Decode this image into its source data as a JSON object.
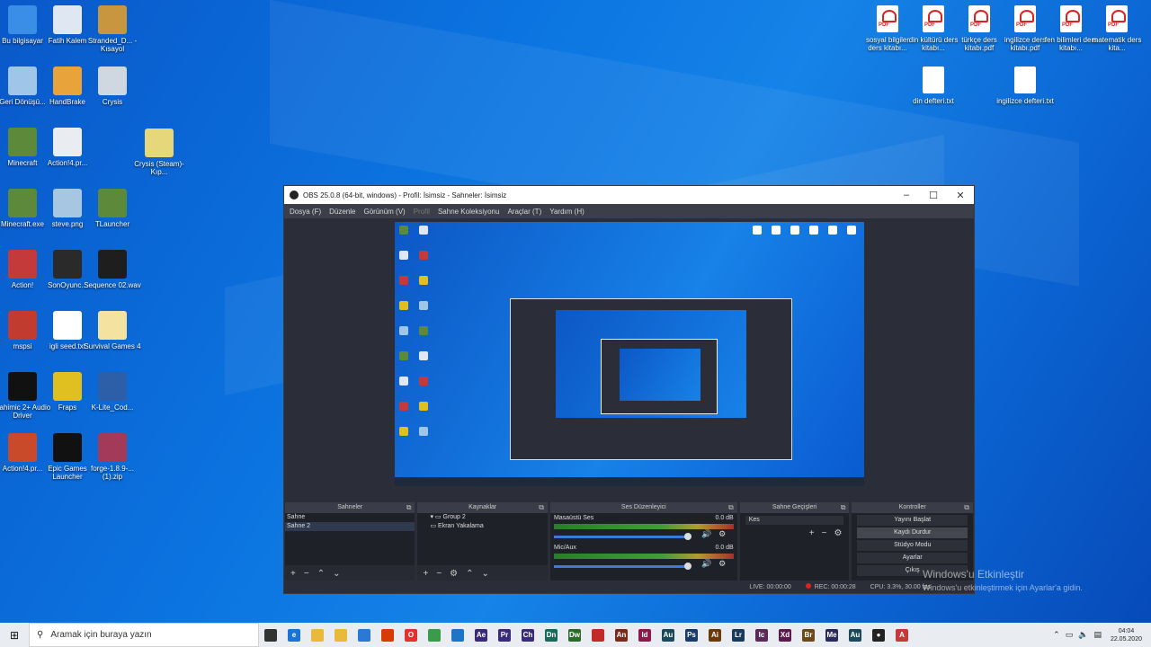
{
  "desktop": {
    "left_icons": [
      {
        "label": "Bu bilgisayar",
        "color": "#3a8ee6"
      },
      {
        "label": "Fatih Kalem",
        "color": "#dfe7f2"
      },
      {
        "label": "Stranded_D... - Kısayol",
        "color": "#c8963e"
      },
      {
        "label": "Geri Dönüşü...",
        "color": "#9fc6e8"
      },
      {
        "label": "HandBrake",
        "color": "#e8a33a"
      },
      {
        "label": "Crysis",
        "color": "#cfd8e0"
      },
      {
        "label": "Minecraft",
        "color": "#5d8a3a"
      },
      {
        "label": "Action!4.pr...",
        "color": "#e9edf2"
      },
      {
        "label": "Crysis (Steam)-Kıp...",
        "color": "#e6d77a"
      },
      {
        "label": "Minecraft.exe",
        "color": "#5d8a3a"
      },
      {
        "label": "steve.png",
        "color": "#a7c6e2"
      },
      {
        "label": "TLauncher",
        "color": "#5d8a3a"
      },
      {
        "label": "Action!",
        "color": "#c43a3a"
      },
      {
        "label": "SonOyunc...",
        "color": "#2a2a2a"
      },
      {
        "label": "Sequence 02.wav",
        "color": "#1e1e1e"
      },
      {
        "label": "mspsi",
        "color": "#c23b2f"
      },
      {
        "label": "igli seed.txt",
        "color": "#ffffff"
      },
      {
        "label": "Survival Games 4",
        "color": "#f4e3a0"
      },
      {
        "label": "Nahimic 2+ Audio Driver",
        "color": "#111111"
      },
      {
        "label": "Fraps",
        "color": "#e0c020"
      },
      {
        "label": "K-Lite_Cod...",
        "color": "#2d5fa8"
      },
      {
        "label": "Action!4.pr...",
        "color": "#c84a2a"
      },
      {
        "label": "Epic Games Launcher",
        "color": "#111111"
      },
      {
        "label": "forge-1.8.9-...(1).zip",
        "color": "#a33a5a"
      }
    ],
    "right_icons": [
      {
        "label": "sosyal bilgiler ders kitabı..."
      },
      {
        "label": "din kültürü ders kitabı..."
      },
      {
        "label": "türkçe ders kitabı.pdf"
      },
      {
        "label": "ingilizce ders kitabı.pdf"
      },
      {
        "label": "fen bilimleri ders kitabı..."
      },
      {
        "label": "matematik ders kita..."
      }
    ],
    "txt_icons": [
      {
        "label": "din defteri.txt"
      },
      {
        "label": "ingilizce defteri.txt"
      }
    ]
  },
  "obs": {
    "title": "OBS 25.0.8 (64-bit, windows) - Profil: İsimsiz - Sahneler: İsimsiz",
    "menu": [
      "Dosya (F)",
      "Düzenle",
      "Görünüm (V)",
      "Profil",
      "Sahne Koleksiyonu",
      "Araçlar (T)",
      "Yardım (H)"
    ],
    "docks": {
      "scenes_title": "Sahneler",
      "scenes": [
        "Sahne",
        "Sahne 2"
      ],
      "sources_title": "Kaynaklar",
      "sources": [
        "Group 2",
        "Ekran Yakalama"
      ],
      "mixer_title": "Ses Düzenleyici",
      "mixer": [
        {
          "name": "Masaüstü Ses",
          "db": "0.0 dB"
        },
        {
          "name": "Mic/Aux",
          "db": "0.0 dB"
        }
      ],
      "transitions_title": "Sahne Geçişleri",
      "transition": "Kes",
      "controls_title": "Kontroller",
      "controls": [
        "Yayını Başlat",
        "Kaydı Durdur",
        "Stüdyo Modu",
        "Ayarlar",
        "Çıkış"
      ]
    },
    "status": {
      "live": "LIVE: 00:00:00",
      "rec": "REC: 00:00:28",
      "cpu": "CPU: 3.3%, 30.00 fps"
    }
  },
  "watermark": {
    "line1": "Windows'u Etkinleştir",
    "line2": "Windows'u etkinleştirmek için Ayarlar'a gidin."
  },
  "taskbar": {
    "search_placeholder": "Aramak için buraya yazın",
    "apps": [
      {
        "icon": "task-view-icon",
        "color": "#333333",
        "glyph": ""
      },
      {
        "icon": "edge-icon",
        "color": "#1a73d9",
        "glyph": "e"
      },
      {
        "icon": "explorer-icon",
        "color": "#e8b93a",
        "glyph": ""
      },
      {
        "icon": "store-icon",
        "color": "#e8b93a",
        "glyph": ""
      },
      {
        "icon": "mail-icon",
        "color": "#2a7ad5",
        "glyph": ""
      },
      {
        "icon": "office-icon",
        "color": "#d83b01",
        "glyph": ""
      },
      {
        "icon": "opera-icon",
        "color": "#e0322f",
        "glyph": "O"
      },
      {
        "icon": "chrome-icon",
        "color": "#3a9b4a",
        "glyph": ""
      },
      {
        "icon": "vscode-icon",
        "color": "#1c75c6",
        "glyph": ""
      },
      {
        "icon": "after-effects-icon",
        "color": "#3a2a7a",
        "glyph": "Ae"
      },
      {
        "icon": "premiere-icon",
        "color": "#3a2a7a",
        "glyph": "Pr"
      },
      {
        "icon": "character-animator-icon",
        "color": "#3a2a7a",
        "glyph": "Ch"
      },
      {
        "icon": "dimension-icon",
        "color": "#1a6a5a",
        "glyph": "Dn"
      },
      {
        "icon": "dreamweaver-icon",
        "color": "#2a6a2a",
        "glyph": "Dw"
      },
      {
        "icon": "acrobat-icon",
        "color": "#c22a2a",
        "glyph": ""
      },
      {
        "icon": "animate-icon",
        "color": "#7a2a1a",
        "glyph": "An"
      },
      {
        "icon": "indesign-icon",
        "color": "#8a1a4a",
        "glyph": "Id"
      },
      {
        "icon": "audition-icon",
        "color": "#1a4a5a",
        "glyph": "Au"
      },
      {
        "icon": "photoshop-icon",
        "color": "#1a3a6a",
        "glyph": "Ps"
      },
      {
        "icon": "illustrator-icon",
        "color": "#6a3a0a",
        "glyph": "Ai"
      },
      {
        "icon": "lightroom-icon",
        "color": "#1a3a5a",
        "glyph": "Lr"
      },
      {
        "icon": "incopy-icon",
        "color": "#5a2a5a",
        "glyph": "Ic"
      },
      {
        "icon": "xd-icon",
        "color": "#5a1a4a",
        "glyph": "Xd"
      },
      {
        "icon": "bridge-icon",
        "color": "#6a4a1a",
        "glyph": "Br"
      },
      {
        "icon": "media-encoder-icon",
        "color": "#2a2a5a",
        "glyph": "Me"
      },
      {
        "icon": "audition2-icon",
        "color": "#1a4a5a",
        "glyph": "Au"
      },
      {
        "icon": "obs-icon",
        "color": "#222222",
        "glyph": "●"
      },
      {
        "icon": "action-icon",
        "color": "#c43a3a",
        "glyph": "A"
      }
    ],
    "time": "04:04",
    "date": "22.05.2020"
  }
}
